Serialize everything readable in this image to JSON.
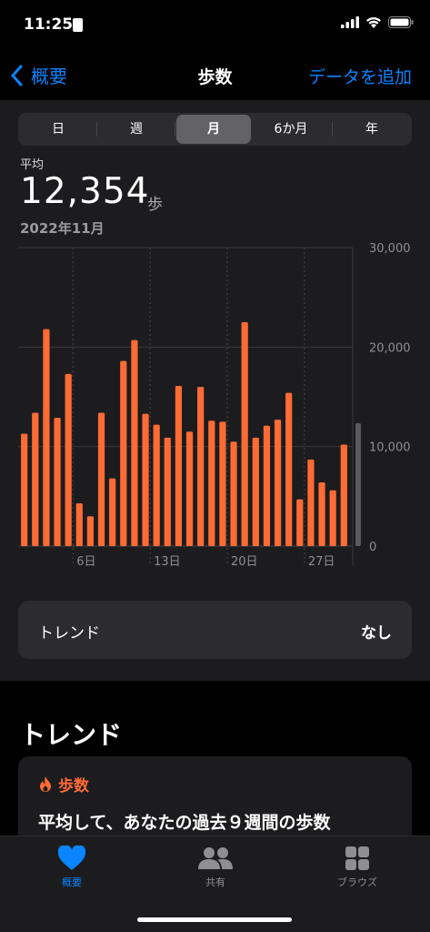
{
  "status_bar": {
    "time": "11:25"
  },
  "nav": {
    "back_label": "概要",
    "title": "歩数",
    "add_label": "データを追加"
  },
  "segments": [
    "日",
    "週",
    "月",
    "6か月",
    "年"
  ],
  "selected_segment": "月",
  "summary": {
    "label": "平均",
    "value": "12,354",
    "unit": "歩",
    "range": "2022年11月"
  },
  "chart_data": {
    "type": "bar",
    "x_unit": "day of November 2022",
    "categories": [
      1,
      2,
      3,
      4,
      5,
      6,
      7,
      8,
      9,
      10,
      11,
      12,
      13,
      14,
      15,
      16,
      17,
      18,
      19,
      20,
      21,
      22,
      23,
      24,
      25,
      26,
      27,
      28,
      29,
      30
    ],
    "values": [
      11300,
      13400,
      21800,
      12900,
      17300,
      4300,
      3000,
      13400,
      6800,
      18600,
      20700,
      13300,
      12200,
      10900,
      16100,
      11500,
      16000,
      12600,
      12500,
      10500,
      22500,
      10900,
      12100,
      12700,
      15400,
      4700,
      8700,
      6400,
      5600,
      10200
    ],
    "average": 12354,
    "x_tick_labels": [
      "6日",
      "13日",
      "20日",
      "27日"
    ],
    "x_tick_days": [
      6,
      13,
      20,
      27
    ],
    "y_ticks": [
      0,
      10000,
      20000,
      30000
    ],
    "y_tick_labels": [
      "0",
      "10,000",
      "20,000",
      "30,000"
    ],
    "ylim": [
      0,
      30000
    ],
    "bar_color": "#ff6b35",
    "average_color": "#5a5a5e",
    "grid": true
  },
  "trend_row": {
    "label": "トレンド",
    "value": "なし"
  },
  "trends": {
    "heading": "トレンド",
    "card_category": "歩数",
    "card_text": "平均して、あなたの過去９週間の歩数"
  },
  "tab_bar": {
    "items": [
      {
        "label": "概要",
        "icon": "heart-icon",
        "color": "#0a84ff",
        "selected": true
      },
      {
        "label": "共有",
        "icon": "people-icon",
        "color": "#8e8e93",
        "selected": false
      },
      {
        "label": "ブラウズ",
        "icon": "grid-icon",
        "color": "#8e8e93",
        "selected": false
      }
    ]
  },
  "colors": {
    "accent": "#0a84ff",
    "steps": "#ff6b35"
  }
}
